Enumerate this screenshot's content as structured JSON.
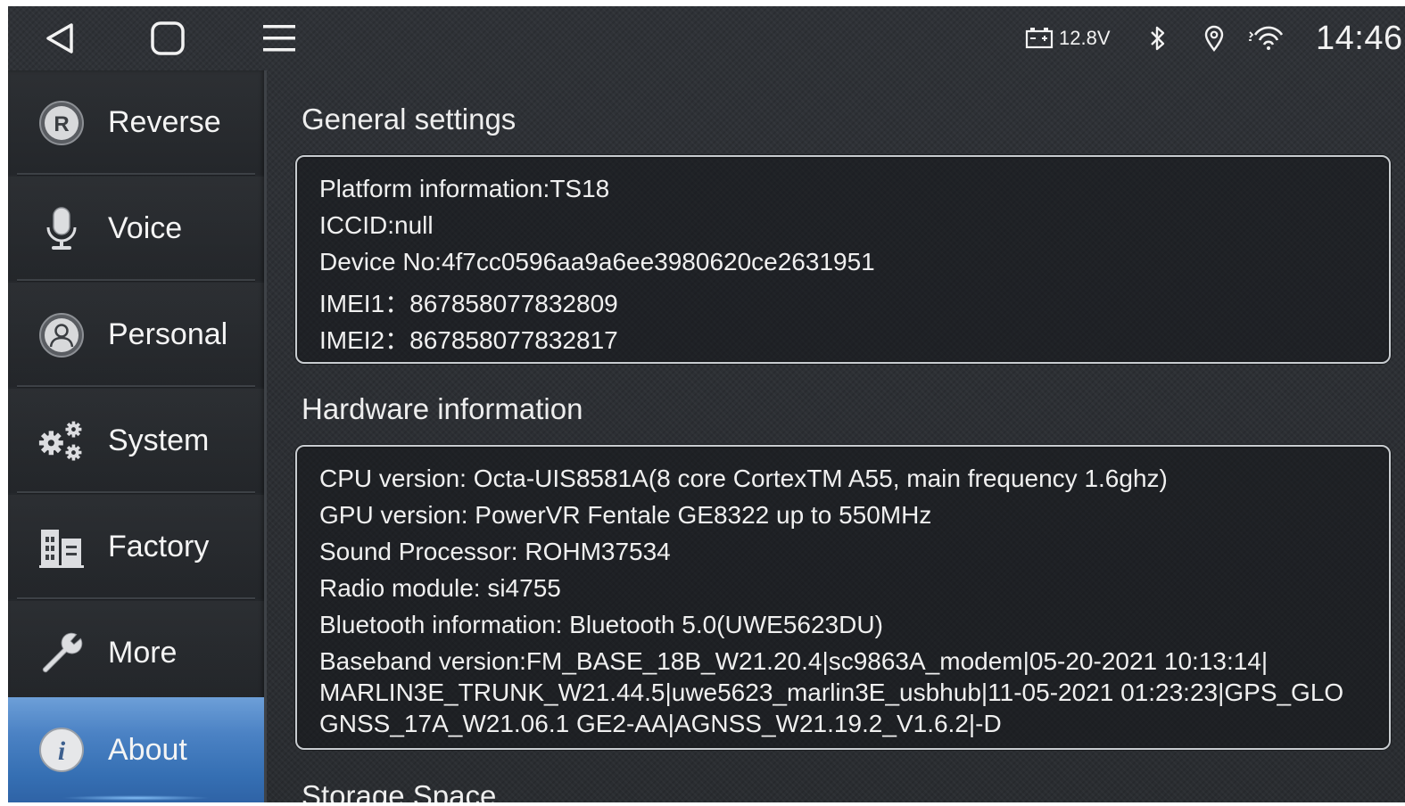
{
  "status_bar": {
    "voltage": "12.8V",
    "time": "14:46",
    "icons": [
      "back-icon",
      "home-icon",
      "menu-icon",
      "battery-icon",
      "bluetooth-icon",
      "location-icon",
      "wifi-icon"
    ]
  },
  "sidebar": {
    "items": [
      {
        "label": "Reverse",
        "icon": "reverse-icon"
      },
      {
        "label": "Voice",
        "icon": "microphone-icon"
      },
      {
        "label": "Personal",
        "icon": "person-icon"
      },
      {
        "label": "System",
        "icon": "gears-icon"
      },
      {
        "label": "Factory",
        "icon": "factory-icon"
      },
      {
        "label": "More",
        "icon": "wrench-icon"
      },
      {
        "label": "About",
        "icon": "info-icon"
      }
    ],
    "active": "About"
  },
  "general": {
    "title": "General settings",
    "lines": [
      "Platform information:TS18",
      "ICCID:null",
      "Device No:4f7cc0596aa9a6ee3980620ce2631951",
      "IMEI1：867858077832809",
      "IMEI2：867858077832817"
    ]
  },
  "hardware": {
    "title": "Hardware information",
    "lines": [
      "CPU version: Octa-UIS8581A(8 core CortexTM A55, main frequency 1.6ghz)",
      "GPU version: PowerVR Fentale GE8322 up to 550MHz",
      "Sound Processor: ROHM37534",
      "Radio module: si4755",
      "Bluetooth information: Bluetooth 5.0(UWE5623DU)",
      "Baseband version:FM_BASE_18B_W21.20.4|sc9863A_modem|05-20-2021 10:13:14|",
      "MARLIN3E_TRUNK_W21.44.5|uwe5623_marlin3E_usbhub|11-05-2021 01:23:23|GPS_GLO",
      "GNSS_17A_W21.06.1 GE2-AA|AGNSS_W21.19.2_V1.6.2|-D"
    ]
  },
  "storage": {
    "title": "Storage Space"
  },
  "colors": {
    "accent": "#4b82c4",
    "background": "#2d3035",
    "text": "#f0f0f0"
  }
}
